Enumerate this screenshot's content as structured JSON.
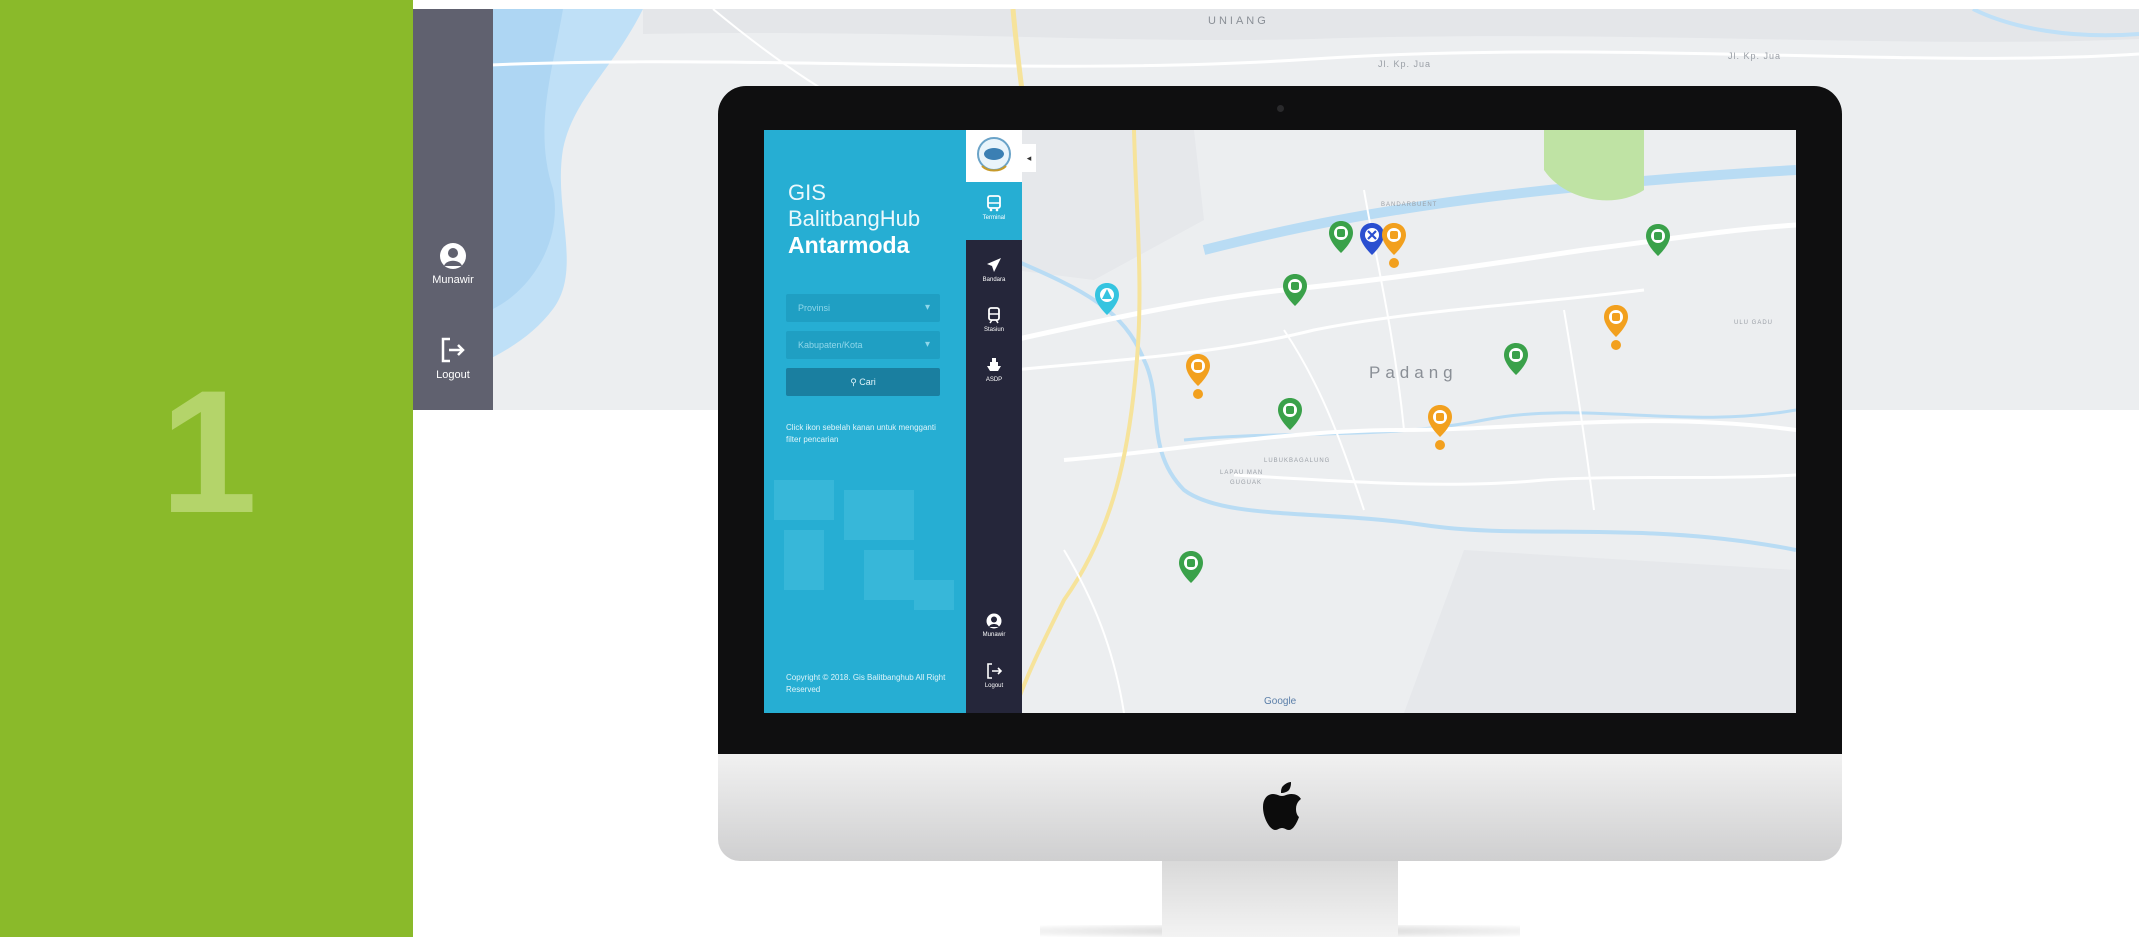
{
  "slide_number": "1",
  "background_app": {
    "user_label": "Munawir",
    "logout_label": "Logout",
    "map_labels": [
      "UNIANG",
      "Jl. Kp. Jua",
      "Jl. Kp. Jua"
    ]
  },
  "app": {
    "title_line1": "GIS",
    "title_line2": "BalitbangHub",
    "title_line3": "Antarmoda",
    "province_placeholder": "Provinsi",
    "city_placeholder": "Kabupaten/Kota",
    "search_label": "Cari",
    "info_text": "Click ikon sebelah kanan untuk mengganti filter pencarian",
    "copyright": "Copyright © 2018. Gis Balitbanghub All Right Reserved",
    "nav": {
      "terminal": "Terminal",
      "bandara": "Bandara",
      "stasiun": "Stasiun",
      "asdp": "ASDP",
      "user": "Munawir",
      "logout": "Logout"
    }
  },
  "map": {
    "city_label": "Padang",
    "district_labels": [
      "BANDARBUENT",
      "LUBUKBAGALUNG",
      "LAPAU MAN",
      "GUGUAK",
      "ULU GADU"
    ],
    "attribution": "Google"
  },
  "colors": {
    "green_panel": "#8aba2a",
    "app_panel": "#26aed3",
    "nav_bar": "#25263a",
    "pin_green": "#3aa14a",
    "pin_orange": "#f2a01e",
    "pin_blue": "#2a4fd0",
    "pin_cyan": "#35c4e0"
  },
  "icons": [
    "bus-icon",
    "plane-icon",
    "train-icon",
    "ship-icon",
    "user-icon",
    "logout-icon",
    "search-icon",
    "apple-logo-icon",
    "map-pin-icon"
  ]
}
